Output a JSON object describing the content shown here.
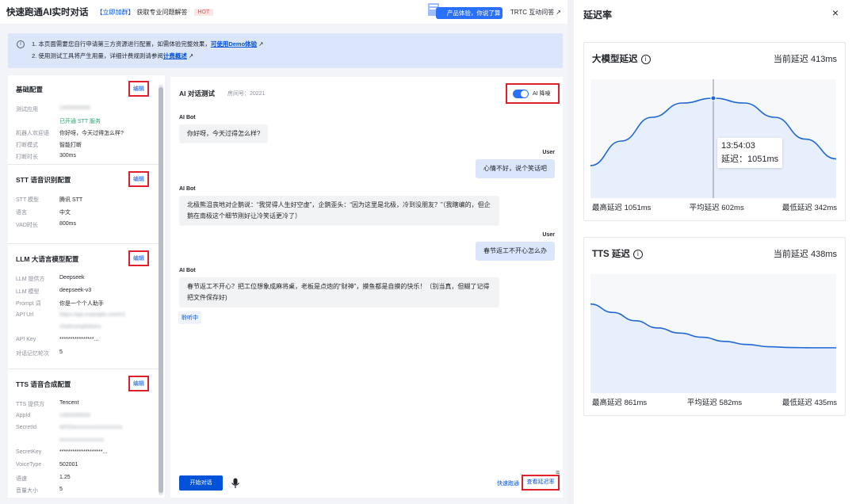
{
  "topbar": {
    "title": "快速跑通AI实时对话",
    "promo_link": "【立即加群】",
    "promo_text": "获取专业问题解答",
    "hot": "HOT",
    "feedback": "产品体验，你说了算",
    "trtc_help": "TRTC 互动问答",
    "ext_icon": "external-link-icon"
  },
  "notice": {
    "line1_prefix": "1. 本页面需要您自行申请第三方资源进行配置，如需体验完整效果，",
    "line1_link": "可使用Demo体验",
    "line2_prefix": "2. 使用测试工具将产生用量，详细计费规则请参阅",
    "line2_link": "计费概述"
  },
  "config": {
    "edit_label": "编辑",
    "sections": [
      {
        "title": "基础配置",
        "rows": [
          {
            "k": "测试应用",
            "v": "1400000000"
          },
          {
            "k": "",
            "v": "已开通 STT 服务"
          },
          {
            "k": "机器人欢迎语",
            "v": "你好呀，今天过得怎么样?"
          },
          {
            "k": "打断模式",
            "v": "智能打断"
          },
          {
            "k": "打断时长",
            "v": "300ms"
          }
        ]
      },
      {
        "title": "STT 语音识别配置",
        "rows": [
          {
            "k": "STT 模型",
            "v": "腾讯 STT"
          },
          {
            "k": "语言",
            "v": "中文"
          },
          {
            "k": "VAD时长",
            "v": "800ms"
          }
        ]
      },
      {
        "title": "LLM 大语言模型配置",
        "rows": [
          {
            "k": "LLM 提供方",
            "v": "Deepseek"
          },
          {
            "k": "LLM 模型",
            "v": "deepseek-v3"
          },
          {
            "k": "Prompt 词",
            "v": "你是一个个人助手"
          },
          {
            "k": "API Url",
            "v": "https://api.example.com/v1"
          },
          {
            "k": "",
            "v": "chat/completions"
          },
          {
            "k": "API Key",
            "v": "****************..."
          },
          {
            "k": "对话记忆轮次",
            "v": "5"
          }
        ]
      },
      {
        "title": "TTS 语音合成配置",
        "rows": [
          {
            "k": "TTS 提供方",
            "v": "Tencent"
          },
          {
            "k": "AppId",
            "v": "1300000000"
          },
          {
            "k": "SecretId",
            "v": "AKIDxxxxxxxxxxxxxxxxxx"
          },
          {
            "k": "",
            "v": "xxxxxxxxxxxxxxxx"
          },
          {
            "k": "SecretKey",
            "v": "********************..."
          },
          {
            "k": "VoiceType",
            "v": "502001"
          },
          {
            "k": "语速",
            "v": "1.25"
          },
          {
            "k": "音量大小",
            "v": "5"
          }
        ]
      }
    ]
  },
  "chat": {
    "title": "AI 对话测试",
    "room": "房间号：20221",
    "ai_denoise": "AI 降噪",
    "bot_label": "AI Bot",
    "user_label": "User",
    "messages": [
      {
        "from": "bot",
        "text": "你好呀，今天过得怎么样?"
      },
      {
        "from": "user",
        "text": "心情不好，说个笑话吧"
      },
      {
        "from": "bot",
        "text": "北极熊沮丧地对企鹅说：“我觉得人生好空虚”，企鹅歪头：“因为这里是北极，冷到没朋友？”（我瞎编的，但企鹅在南极这个细节刚好让冷笑话更冷了）"
      },
      {
        "from": "user",
        "text": "春节返工不开心怎么办"
      },
      {
        "from": "bot",
        "text": "春节返工不开心？把工位想象成麻将桌，老板是点炮的“财神”，摸鱼都是自摸的快乐！（别当真，但糊了记得把文件保存好)"
      }
    ],
    "listening": "聆听中",
    "start_button": "开始对话",
    "quick_link": "快速跑通",
    "latency_button": "查看延迟率"
  },
  "latency": {
    "title": "延迟率",
    "close": "×",
    "llm": {
      "title": "大模型延迟",
      "current": "当前延迟 413ms",
      "max": "最高延迟 1051ms",
      "avg": "平均延迟 602ms",
      "min": "最低延迟 342ms",
      "tooltip_time": "13:54:03",
      "tooltip_value": "延迟：1051ms"
    },
    "tts": {
      "title": "TTS 延迟",
      "current": "当前延迟 438ms",
      "max": "最高延迟 861ms",
      "avg": "平均延迟 582ms",
      "min": "最低延迟 435ms"
    }
  },
  "chart_data": [
    {
      "type": "area",
      "series": [
        {
          "values": [
            342,
            600,
            850,
            1000,
            1051,
            1000,
            850,
            620,
            413
          ]
        }
      ],
      "highlight_index": 4,
      "color": "#1f67d2"
    },
    {
      "type": "area",
      "series": [
        {
          "values": [
            861,
            780,
            700,
            630,
            580,
            540,
            500,
            470,
            448,
            440,
            438,
            438
          ]
        }
      ],
      "color": "#1f67d2"
    }
  ]
}
